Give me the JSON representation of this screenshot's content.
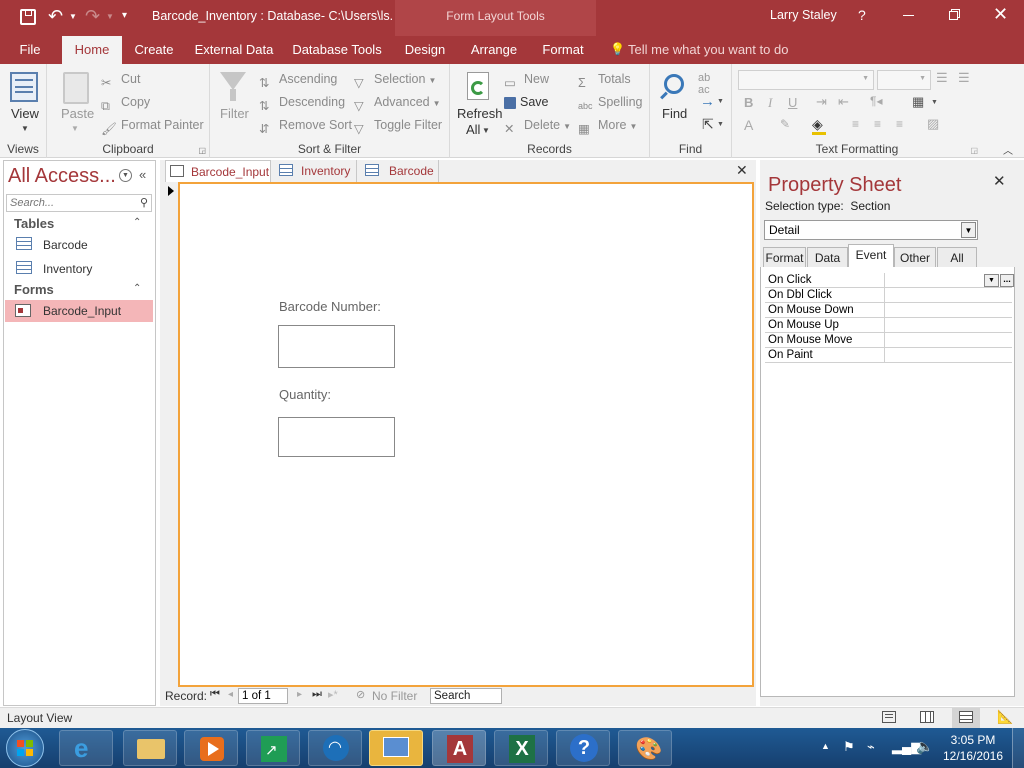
{
  "titlebar": {
    "title": "Barcode_Inventory : Database- C:\\Users\\ls...",
    "context": "Form Layout Tools",
    "user": "Larry Staley",
    "help": "?"
  },
  "tabs": [
    {
      "label": "File"
    },
    {
      "label": "Home"
    },
    {
      "label": "Create"
    },
    {
      "label": "External Data"
    },
    {
      "label": "Database Tools"
    },
    {
      "label": "Design"
    },
    {
      "label": "Arrange"
    },
    {
      "label": "Format"
    }
  ],
  "tellme": "Tell me what you want to do",
  "ribbon": {
    "views": {
      "view": "View",
      "label": "Views"
    },
    "clipboard": {
      "paste": "Paste",
      "cut": "Cut",
      "copy": "Copy",
      "format_painter": "Format Painter",
      "label": "Clipboard"
    },
    "sort": {
      "filter": "Filter",
      "ascending": "Ascending",
      "descending": "Descending",
      "remove_sort": "Remove Sort",
      "selection": "Selection",
      "advanced": "Advanced",
      "toggle_filter": "Toggle Filter",
      "label": "Sort & Filter"
    },
    "records": {
      "refresh": "Refresh",
      "all": "All",
      "new": "New",
      "save": "Save",
      "delete": "Delete",
      "totals": "Totals",
      "spelling": "Spelling",
      "more": "More",
      "label": "Records"
    },
    "find": {
      "find": "Find",
      "label": "Find"
    },
    "text": {
      "label": "Text Formatting",
      "bold": "B",
      "italic": "I",
      "underline": "U",
      "fontcolor": "A"
    }
  },
  "nav": {
    "title": "All Access...",
    "search_placeholder": "Search...",
    "tables_header": "Tables",
    "tables": [
      "Barcode",
      "Inventory"
    ],
    "forms_header": "Forms",
    "forms": [
      "Barcode_Input"
    ]
  },
  "doc_tabs": [
    "Barcode_Input",
    "Inventory",
    "Barcode"
  ],
  "form": {
    "barcode_label": "Barcode Number:",
    "quantity_label": "Quantity:"
  },
  "record_nav": {
    "label": "Record:",
    "position": "1 of 1",
    "filter": "No Filter",
    "search": "Search"
  },
  "property_sheet": {
    "title": "Property Sheet",
    "selection_type": "Selection type:  Section",
    "selected": "Detail",
    "tabs": [
      "Format",
      "Data",
      "Event",
      "Other",
      "All"
    ],
    "active_tab": "Event",
    "properties": [
      "On Click",
      "On Dbl Click",
      "On Mouse Down",
      "On Mouse Up",
      "On Mouse Move",
      "On Paint"
    ]
  },
  "status": {
    "view": "Layout View"
  },
  "taskbar": {
    "time": "3:05 PM",
    "date": "12/16/2016"
  }
}
